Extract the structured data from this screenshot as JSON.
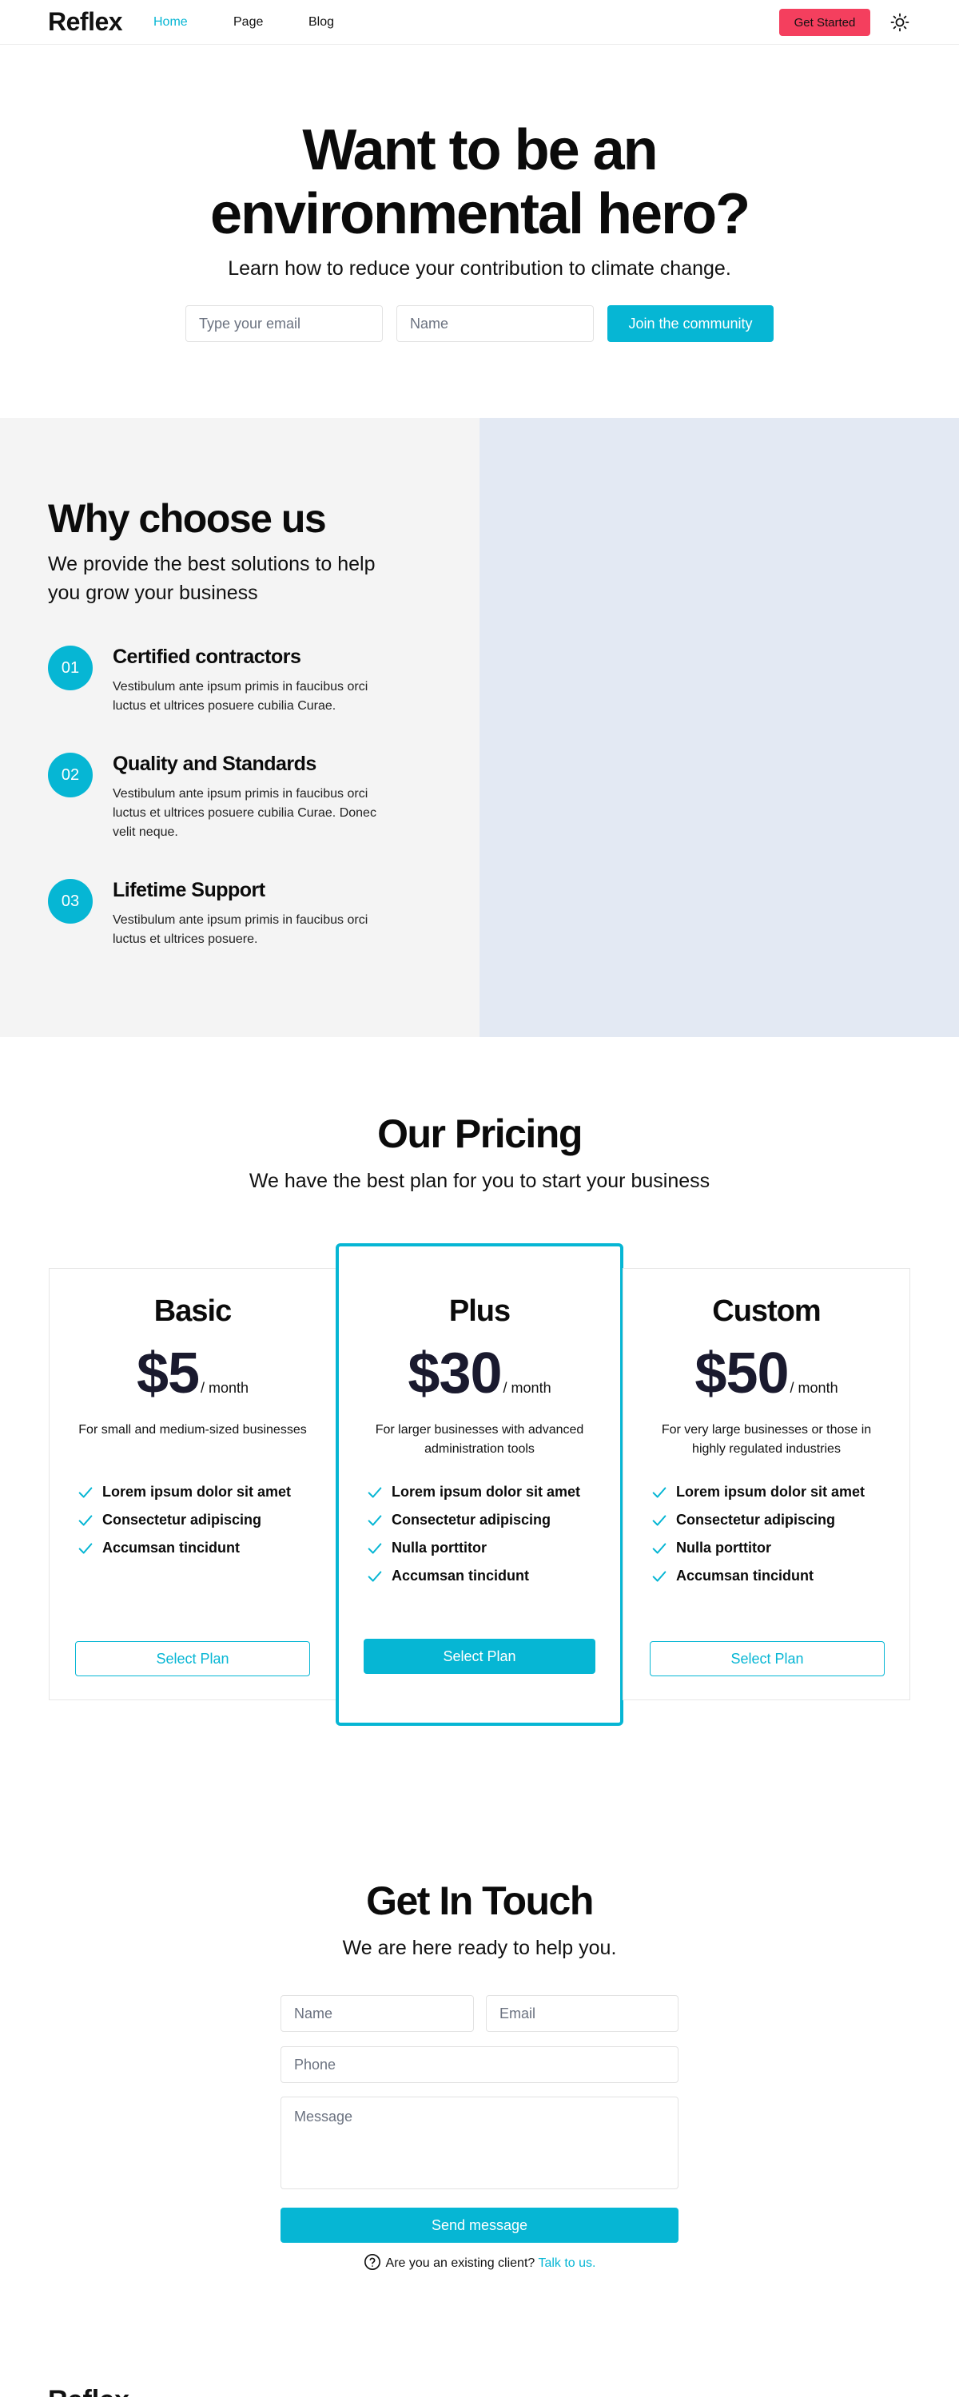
{
  "nav": {
    "brand": "Reflex",
    "links": [
      {
        "label": "Home",
        "active": true
      },
      {
        "label": "Page",
        "active": false
      },
      {
        "label": "Blog",
        "active": false
      }
    ],
    "cta_label": "Get Started",
    "theme_icon": "sun-icon"
  },
  "hero": {
    "title_line1": "Want to be an",
    "title_line2": "environmental hero?",
    "subtitle": "Learn how to reduce your contribution to climate change.",
    "email_placeholder": "Type your email",
    "name_placeholder": "Name",
    "join_label": "Join the community"
  },
  "why": {
    "title": "Why choose us",
    "subtitle": "We provide the best solutions to help you grow your business",
    "features": [
      {
        "num": "01",
        "title": "Certified contractors",
        "desc": "Vestibulum ante ipsum primis in faucibus orci luctus et ultrices posuere cubilia Curae."
      },
      {
        "num": "02",
        "title": "Quality and Standards",
        "desc": "Vestibulum ante ipsum primis in faucibus orci luctus et ultrices posuere cubilia Curae. Donec velit neque."
      },
      {
        "num": "03",
        "title": "Lifetime Support",
        "desc": "Vestibulum ante ipsum primis in faucibus orci luctus et ultrices posuere."
      }
    ]
  },
  "pricing": {
    "title": "Our Pricing",
    "subtitle": "We have the best plan for you to start your business",
    "plans": [
      {
        "name": "Basic",
        "price": "$5",
        "period": "/ month",
        "desc": "For small and medium-sized businesses",
        "features": [
          "Lorem ipsum dolor sit amet",
          "Consectetur adipiscing",
          "Accumsan tincidunt"
        ],
        "button": "Select Plan",
        "featured": false
      },
      {
        "name": "Plus",
        "price": "$30",
        "period": "/ month",
        "desc": "For larger businesses with advanced administration tools",
        "features": [
          "Lorem ipsum dolor sit amet",
          "Consectetur adipiscing",
          "Nulla porttitor",
          "Accumsan tincidunt"
        ],
        "button": "Select Plan",
        "featured": true
      },
      {
        "name": "Custom",
        "price": "$50",
        "period": "/ month",
        "desc": "For very large businesses or those in highly regulated industries",
        "features": [
          "Lorem ipsum dolor sit amet",
          "Consectetur adipiscing",
          "Nulla porttitor",
          "Accumsan tincidunt"
        ],
        "button": "Select Plan",
        "featured": false
      }
    ]
  },
  "contact": {
    "title": "Get In Touch",
    "subtitle": "We are here ready to help you.",
    "name_placeholder": "Name",
    "email_placeholder": "Email",
    "phone_placeholder": "Phone",
    "message_placeholder": "Message",
    "submit_label": "Send message",
    "note_text": "Are you an existing client?",
    "note_link": "Talk to us."
  },
  "footer": {
    "brand": "Reflex"
  },
  "colors": {
    "accent": "#06b6d4",
    "cta": "#f43f5e",
    "panel_gray": "#f4f4f4",
    "panel_blue": "#e3e9f3"
  }
}
